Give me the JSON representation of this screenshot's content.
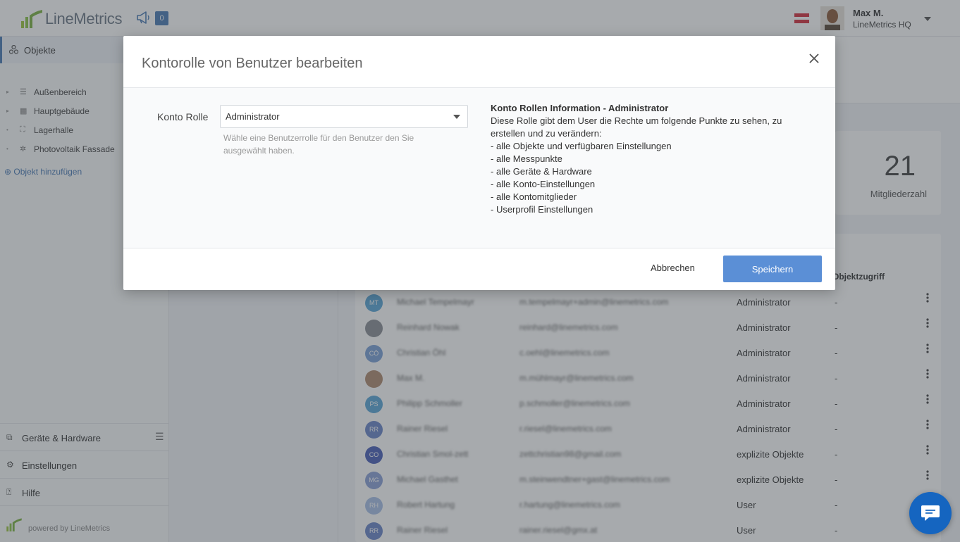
{
  "app": {
    "logo_text": "LineMetrics",
    "notification_count": "0",
    "user_name": "Max M.",
    "user_org": "LineMetrics HQ"
  },
  "sidebar": {
    "objects_label": "Objekte",
    "tree": [
      {
        "label": "Außenbereich",
        "icon": "list-icon"
      },
      {
        "label": "Hauptgebäude",
        "icon": "building-icon"
      },
      {
        "label": "Lagerhalle",
        "icon": "warehouse-icon"
      },
      {
        "label": "Photovoltaik Fassade",
        "icon": "sun-icon"
      }
    ],
    "add_object": "Objekt hinzufügen",
    "bottom": [
      {
        "label": "Geräte & Hardware",
        "icon": "device-icon"
      },
      {
        "label": "Einstellungen",
        "icon": "gear-icon"
      },
      {
        "label": "Hilfe",
        "icon": "help-icon"
      }
    ],
    "powered_by": "powered by LineMetrics"
  },
  "stats": {
    "members_count": "21",
    "members_label": "Mitgliederzahl"
  },
  "table": {
    "header_objektzugriff": "Objektzugriff",
    "rows": [
      {
        "initials": "MT",
        "name": "Michael Tempelmayr",
        "email": "m.tempelmayr+admin@linemetrics.com",
        "role": "Administrator",
        "access": "-",
        "color": "#5aa6d8"
      },
      {
        "initials": "",
        "name": "Reinhard Nowak",
        "email": "reinhard@linemetrics.com",
        "role": "Administrator",
        "access": "-",
        "color": "#8a8f96"
      },
      {
        "initials": "CÖ",
        "name": "Christian Öhl",
        "email": "c.oehl@linemetrics.com",
        "role": "Administrator",
        "access": "-",
        "color": "#7aa0d8"
      },
      {
        "initials": "",
        "name": "Max M.",
        "email": "m.mühlmayr@linemetrics.com",
        "role": "Administrator",
        "access": "-",
        "color": "#b08a70"
      },
      {
        "initials": "PS",
        "name": "Philipp Schmoller",
        "email": "p.schmoller@linemetrics.com",
        "role": "Administrator",
        "access": "-",
        "color": "#5aa6d8"
      },
      {
        "initials": "RR",
        "name": "Rainer Riesel",
        "email": "r.riesel@linemetrics.com",
        "role": "Administrator",
        "access": "-",
        "color": "#6a86c8"
      },
      {
        "initials": "CO",
        "name": "Christian Smol-zett",
        "email": "zettchristian98@gmail.com",
        "role": "explizite Objekte",
        "access": "-",
        "color": "#4a5fb8"
      },
      {
        "initials": "MG",
        "name": "Michael Gasthet",
        "email": "m.steinwendtner+gast@linemetrics.com",
        "role": "explizite Objekte",
        "access": "-",
        "color": "#8aa0d8"
      },
      {
        "initials": "RH",
        "name": "Robert Hartung",
        "email": "r.hartung@linemetrics.com",
        "role": "User",
        "access": "-",
        "color": "#a8c0e8"
      },
      {
        "initials": "RR",
        "name": "Rainer Riesel",
        "email": "rainer.riesel@gmx.at",
        "role": "User",
        "access": "-",
        "color": "#6a86c8"
      }
    ]
  },
  "modal": {
    "title": "Kontorolle von Benutzer bearbeiten",
    "field_label": "Konto Rolle",
    "select_value": "Administrator",
    "help_text": "Wähle eine Benutzerrolle für den Benutzer den Sie ausgewählt haben.",
    "info_title": "Konto Rollen Information - Administrator",
    "info_lines": [
      "Diese Rolle gibt dem User die Rechte um folgende Punkte zu sehen, zu erstellen und zu verändern:",
      "- alle Objekte und verfügbaren Einstellungen",
      "- alle Messpunkte",
      "- alle Geräte & Hardware",
      "- alle Konto-Einstellungen",
      "- alle Kontomitglieder",
      "- Userprofil Einstellungen"
    ],
    "cancel_label": "Abbrechen",
    "save_label": "Speichern"
  },
  "colors": {
    "accent": "#4a7ab5",
    "save_button": "#5b8fd6",
    "chat_button": "#1565c0"
  }
}
